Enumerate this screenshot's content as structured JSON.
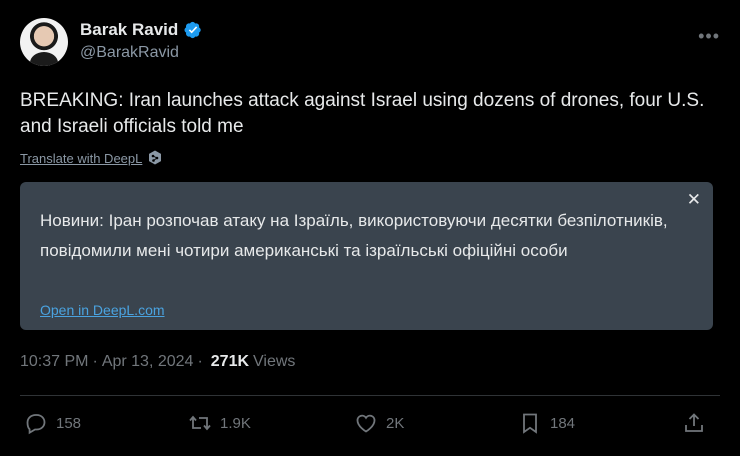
{
  "author": {
    "display_name": "Barak Ravid",
    "handle": "@BarakRavid"
  },
  "tweet": {
    "text": "BREAKING: Iran launches attack against Israel using dozens of drones, four U.S. and Israeli officials told me",
    "translate_label": "Translate with DeepL"
  },
  "translation": {
    "text": "Новини: Іран розпочав атаку на Ізраїль, використовуючи десятки безпілотників, повідомили мені чотири американські та ізраїльські офіційні особи",
    "open_label": "Open in DeepL.com",
    "close_symbol": "✕"
  },
  "meta": {
    "time": "10:37 PM",
    "separator": "·",
    "date": "Apr 13, 2024",
    "views_count": "271K",
    "views_label": "Views"
  },
  "actions": {
    "replies": "158",
    "reposts": "1.9K",
    "likes": "2K",
    "bookmarks": "184"
  },
  "colors": {
    "background": "#000000",
    "translation_bg": "#3a444e",
    "verified": "#1d9bf0",
    "link": "#4aa3e0",
    "muted": "#71767b"
  },
  "icons": [
    "verified-badge-icon",
    "deepl-icon",
    "more-icon",
    "close-icon",
    "reply-icon",
    "repost-icon",
    "like-icon",
    "bookmark-icon",
    "share-icon"
  ]
}
